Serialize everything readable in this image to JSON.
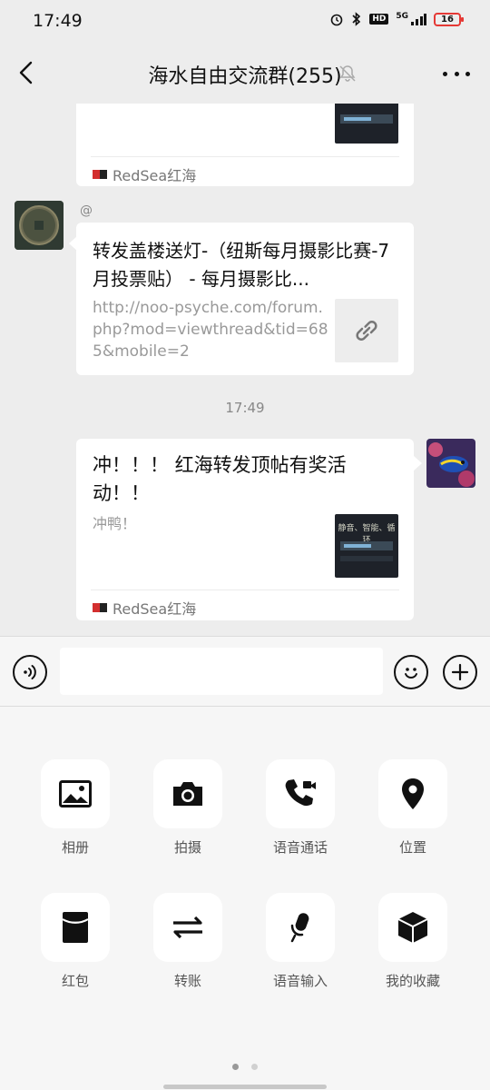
{
  "status_bar": {
    "time": "17:49",
    "hd": "HD",
    "network": "5G",
    "battery": "16"
  },
  "header": {
    "title": "海水自由交流群(255)"
  },
  "messages": {
    "card1": {
      "source": "RedSea红海"
    },
    "link_msg": {
      "sender": "@",
      "title": "转发盖楼送灯-（纽斯每月摄影比赛-7月投票贴） - 每月摄影比...",
      "url": "http://noo-psyche.com/forum.php?mod=viewthread&tid=685&mobile=2"
    },
    "timestamp": "17:49",
    "card2": {
      "title": "冲！！！ 红海转发顶帖有奖活动！！",
      "desc": "冲鸭！",
      "thumb_text": "静音、智能、循环",
      "source": "RedSea红海"
    }
  },
  "input": {
    "placeholder": ""
  },
  "tools": [
    {
      "label": "相册",
      "icon": "photo-icon"
    },
    {
      "label": "拍摄",
      "icon": "camera-icon"
    },
    {
      "label": "语音通话",
      "icon": "voice-call-icon"
    },
    {
      "label": "位置",
      "icon": "location-icon"
    },
    {
      "label": "红包",
      "icon": "red-packet-icon"
    },
    {
      "label": "转账",
      "icon": "transfer-icon"
    },
    {
      "label": "语音输入",
      "icon": "voice-input-icon"
    },
    {
      "label": "我的收藏",
      "icon": "favorites-icon"
    }
  ],
  "colors": {
    "background": "#ededed",
    "bubble": "#ffffff",
    "panel": "#f6f6f6",
    "text": "#111111",
    "muted": "#888888"
  }
}
